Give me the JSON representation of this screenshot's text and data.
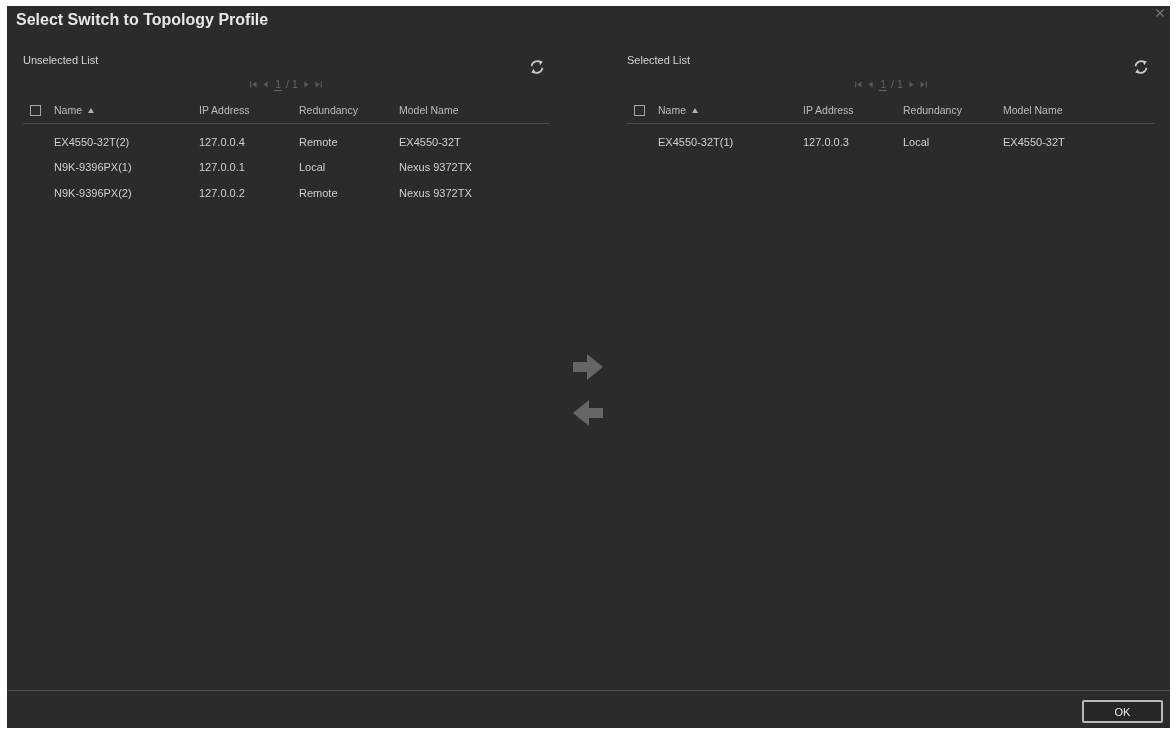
{
  "window": {
    "title": "Select Switch to Topology Profile"
  },
  "panels": [
    {
      "label": "Unselected List",
      "pager": {
        "current": "1",
        "total": "/ 1",
        "disabled": true
      },
      "select_all": {
        "checked": false
      },
      "columns": [
        {
          "label": "Name",
          "sorted": true
        },
        {
          "label": "IP Address",
          "sorted": false
        },
        {
          "label": "Redundancy",
          "sorted": false
        },
        {
          "label": "Model Name",
          "sorted": false
        }
      ],
      "rows": [
        [
          "EX4550-32T(2)",
          "127.0.0.4",
          "Remote",
          "EX4550-32T"
        ],
        [
          "N9K-9396PX(1)",
          "127.0.0.1",
          "Local",
          "Nexus 9372TX"
        ],
        [
          "N9K-9396PX(2)",
          "127.0.0.2",
          "Remote",
          "Nexus 9372TX"
        ]
      ]
    },
    {
      "label": "Selected List",
      "pager": {
        "current": "1",
        "total": "/ 1",
        "disabled": true
      },
      "select_all": {
        "checked": false
      },
      "columns": [
        {
          "label": "Name",
          "sorted": true
        },
        {
          "label": "IP Address",
          "sorted": false
        },
        {
          "label": "Redundancy",
          "sorted": false
        },
        {
          "label": "Model Name",
          "sorted": false
        }
      ],
      "rows": [
        [
          "EX4550-32T(1)",
          "127.0.0.3",
          "Local",
          "EX4550-32T"
        ]
      ]
    }
  ],
  "transfer_buttons": [
    {
      "kind": "add",
      "disabled": true
    },
    {
      "kind": "remove",
      "disabled": true
    }
  ],
  "buttons": [
    {
      "label": "OK"
    }
  ]
}
